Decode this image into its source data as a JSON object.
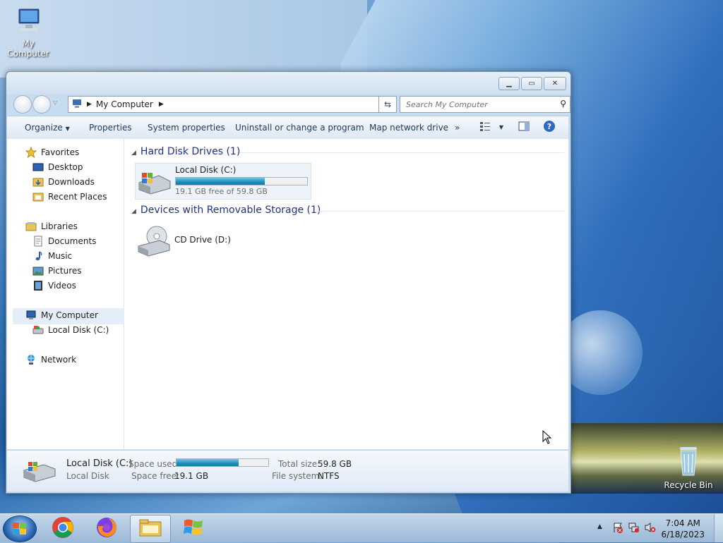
{
  "desktop": {
    "icons": [
      {
        "label": "My Computer"
      },
      {
        "label": "Recycle Bin"
      }
    ]
  },
  "window": {
    "title": "",
    "address": {
      "crumbs": [
        "My Computer"
      ]
    },
    "search": {
      "placeholder": "Search My Computer"
    },
    "toolbar": {
      "organize": "Organize",
      "properties": "Properties",
      "system_properties": "System properties",
      "uninstall": "Uninstall or change a program",
      "map_drive": "Map network drive",
      "overflow": "»",
      "help": "?"
    },
    "nav": {
      "favorites": "Favorites",
      "desktop": "Desktop",
      "downloads": "Downloads",
      "recent": "Recent Places",
      "libraries": "Libraries",
      "documents": "Documents",
      "music": "Music",
      "pictures": "Pictures",
      "videos": "Videos",
      "my_computer": "My Computer",
      "local_disk": "Local Disk (C:)",
      "network": "Network"
    },
    "content": {
      "hdd_group": "Hard Disk Drives (1)",
      "removable_group": "Devices with Removable Storage (1)",
      "drive_c": {
        "name": "Local Disk (C:)",
        "free_text": "19.1 GB free of 59.8 GB",
        "used_fraction": 0.68
      },
      "drive_d": {
        "name": "CD Drive (D:)"
      }
    },
    "details": {
      "name": "Local Disk (C:)",
      "type": "Local Disk",
      "space_used_label": "Space used:",
      "space_free_label": "Space free:",
      "space_free_value": "19.1 GB",
      "total_size_label": "Total size:",
      "total_size_value": "59.8 GB",
      "fs_label": "File system:",
      "fs_value": "NTFS",
      "used_fraction": 0.68
    }
  },
  "taskbar": {
    "clock_time": "7:04 AM",
    "clock_date": "6/18/2023"
  },
  "colors": {
    "accent": "#1f8fb8",
    "group_header": "#1e3287"
  }
}
